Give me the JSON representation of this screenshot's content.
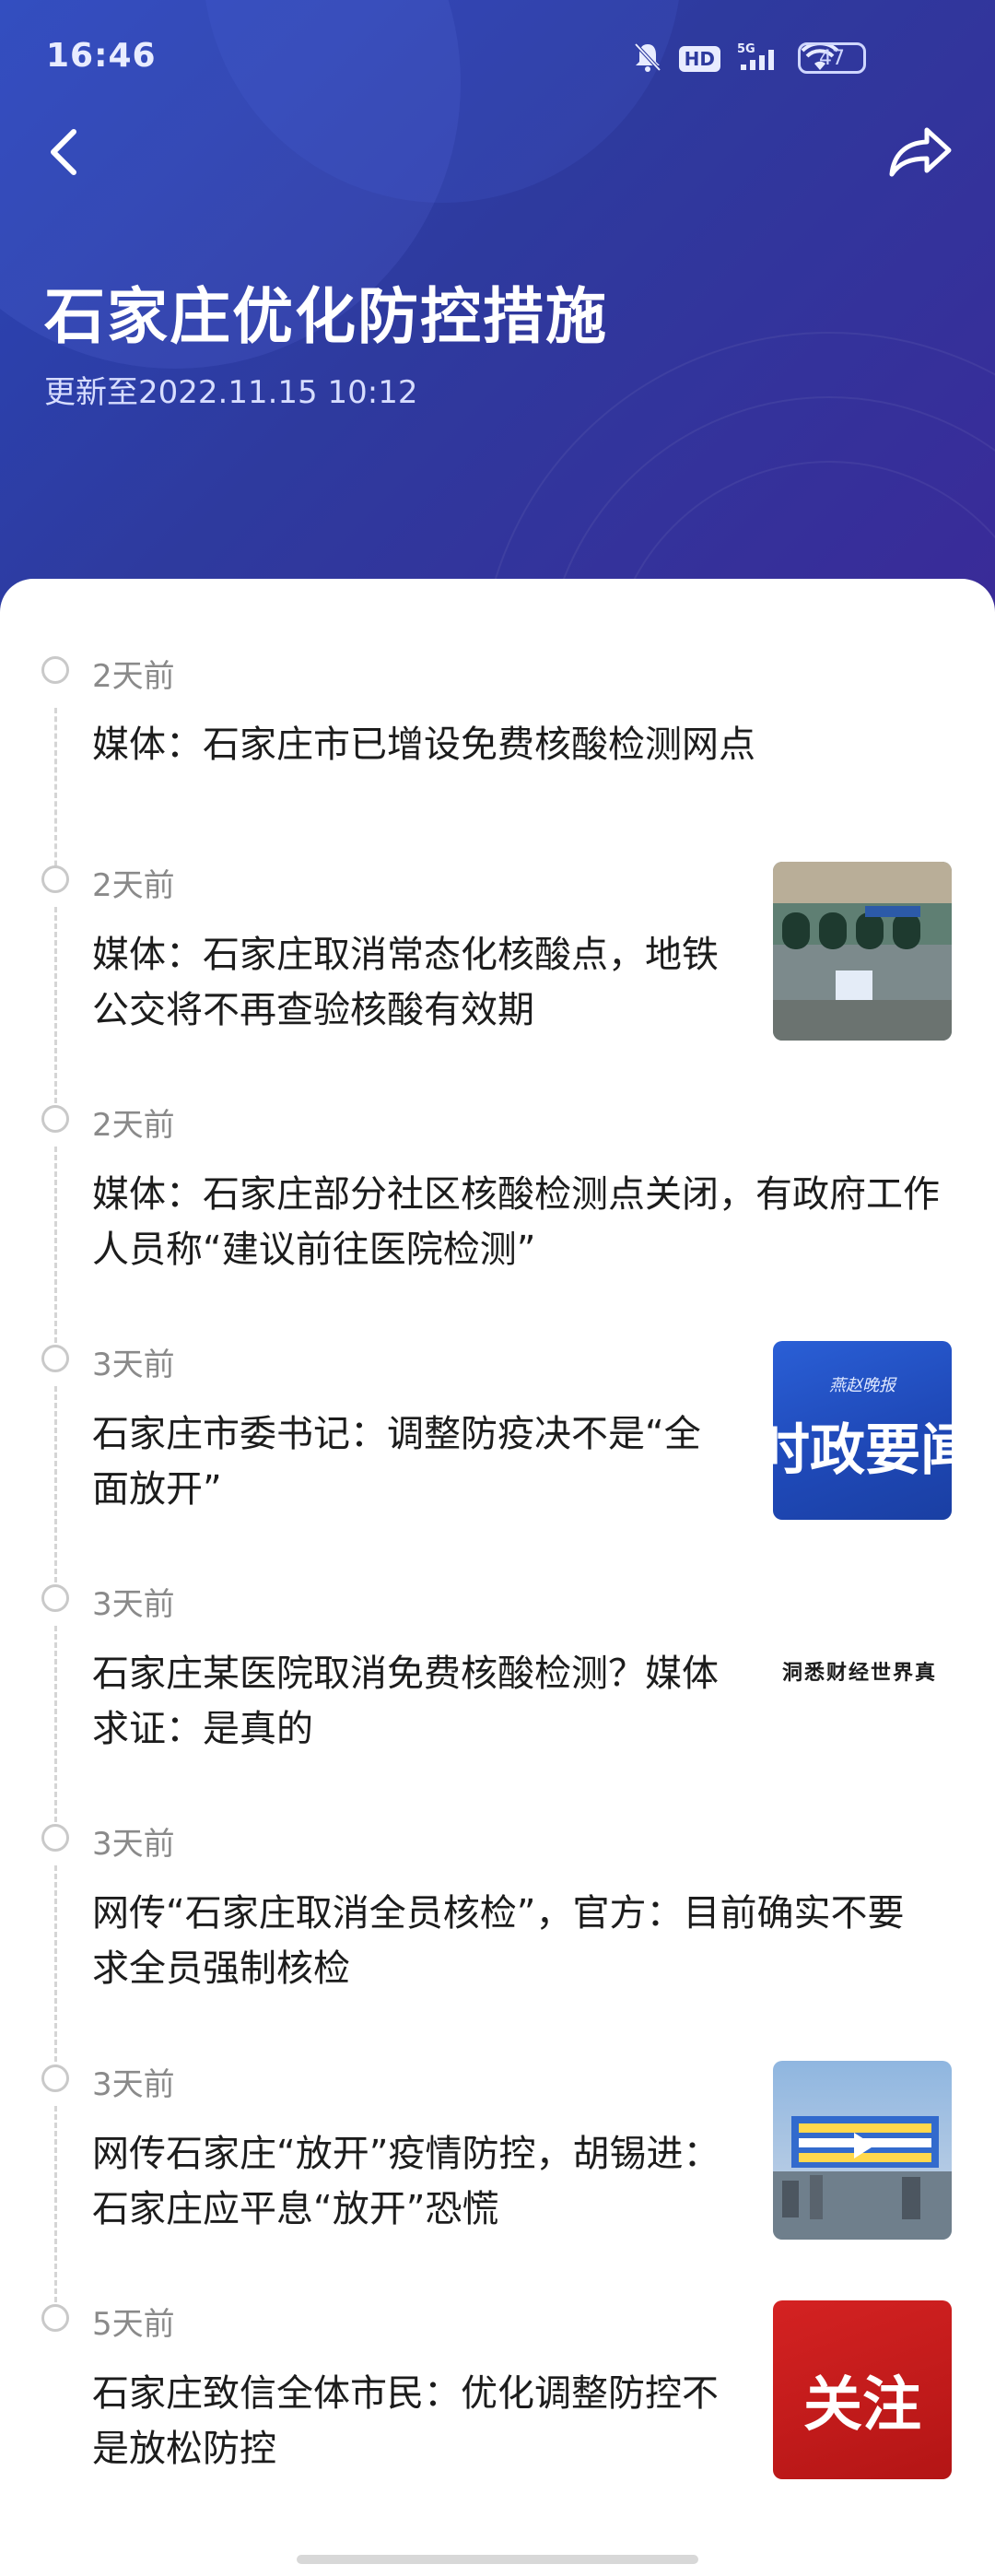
{
  "status_bar": {
    "time": "16:46",
    "hd_badge": "HD",
    "network": "5G",
    "battery": "47"
  },
  "header": {
    "title": "石家庄优化防控措施",
    "updated": "更新至2022.11.15 10:12"
  },
  "items": [
    {
      "time": "2天前",
      "headline": "媒体：石家庄市已增设免费核酸检测网点"
    },
    {
      "time": "2天前",
      "headline": "媒体：石家庄取消常态化核酸点，地铁公交将不再查验核酸有效期"
    },
    {
      "time": "2天前",
      "headline": "媒体：石家庄部分社区核酸检测点关闭，有政府工作人员称“建议前往医院检测”"
    },
    {
      "time": "3天前",
      "headline": "石家庄市委书记：调整防疫决不是“全面放开”",
      "thumb_text": "时政要闻",
      "thumb_caption": "燕赵晚报"
    },
    {
      "time": "3天前",
      "headline": "石家庄某医院取消免费核酸检测？媒体求证：是真的",
      "thumb_text": "洞悉财经世界真"
    },
    {
      "time": "3天前",
      "headline": "网传“石家庄取消全员核检”，官方：目前确实不要求全员强制核检"
    },
    {
      "time": "3天前",
      "headline": "网传石家庄“放开”疫情防控，胡锡进：石家庄应平息“放开”恐慌"
    },
    {
      "time": "5天前",
      "headline": "石家庄致信全体市民：优化调整防控不是放松防控",
      "thumb_text": "关注"
    }
  ],
  "colors": {
    "header_start": "#2a46b8",
    "header_end": "#3a2a98",
    "text_primary": "#1c1c1c",
    "text_secondary": "#8a8a8a"
  }
}
